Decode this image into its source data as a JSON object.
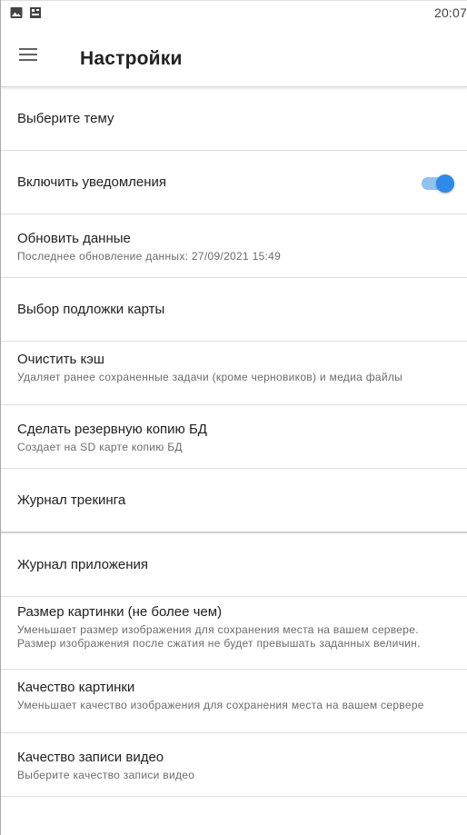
{
  "status_bar": {
    "time": "20:07",
    "icons": [
      "image-icon",
      "app-notification-icon"
    ]
  },
  "app_bar": {
    "menu_icon": "hamburger-menu-icon",
    "title": "Настройки"
  },
  "settings": [
    {
      "title": "Выберите тему"
    },
    {
      "title": "Включить уведомления",
      "toggle": true
    },
    {
      "title": "Обновить данные",
      "subtitle": "Последнее обновление данных:  27/09/2021   15:49"
    },
    {
      "title": "Выбор подложки карты"
    },
    {
      "title": "Очистить кэш",
      "subtitle": "Удаляет ранее сохраненные задачи (кроме черновиков) и медиа файлы"
    },
    {
      "title": "Сделать резервную копию БД",
      "subtitle": "Создает на SD карте копию БД"
    },
    {
      "title": "Журнал трекинга"
    },
    {
      "title": "Журнал приложения"
    },
    {
      "title": "Размер картинки (не более чем)",
      "subtitle": "Уменьшает размер изображения для сохранения места на вашем сервере. Размер изображения после сжатия не будет превышать заданных величин."
    },
    {
      "title": "Качество картинки",
      "subtitle": "Уменьшает качество изображения для сохранения места на вашем сервере"
    },
    {
      "title": "Качество записи видео",
      "subtitle": "Выберите качество записи видео"
    }
  ],
  "colors": {
    "toggle_thumb": "#2e8ae6",
    "toggle_track": "#90c2ee",
    "divider": "#dedede"
  }
}
